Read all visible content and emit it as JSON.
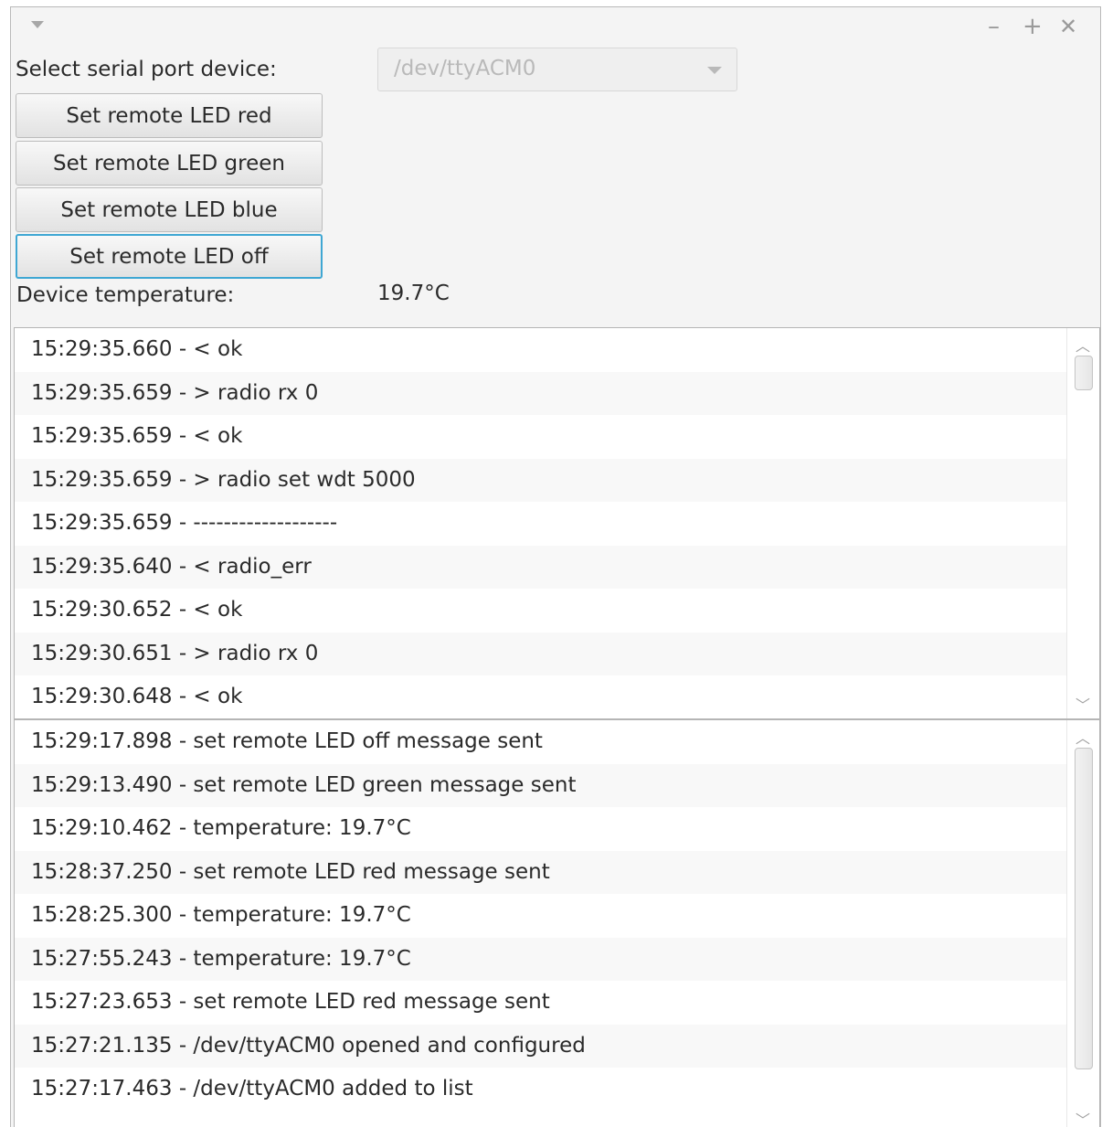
{
  "window": {
    "minimize": "–",
    "maximize": "+",
    "close": "✕"
  },
  "port": {
    "label": "Select serial port device:",
    "selected": "/dev/ttyACM0"
  },
  "buttons": {
    "red": "Set remote LED red",
    "green": "Set remote LED green",
    "blue": "Set remote LED blue",
    "off": "Set remote LED off"
  },
  "temperature": {
    "label": "Device temperature:",
    "value": "19.7°C"
  },
  "serial_log": [
    "15:29:35.660 - < ok",
    "15:29:35.659 - > radio rx 0",
    "15:29:35.659 - < ok",
    "15:29:35.659 - > radio set wdt 5000",
    "15:29:35.659 - -------------------",
    "15:29:35.640 - < radio_err",
    "15:29:30.652 - < ok",
    "15:29:30.651 - > radio rx 0",
    "15:29:30.648 - < ok"
  ],
  "event_log": [
    "15:29:17.898 - set remote LED off message sent",
    "15:29:13.490 - set remote LED green message sent",
    "15:29:10.462 - temperature: 19.7°C",
    "15:28:37.250 - set remote LED red message sent",
    "15:28:25.300 - temperature: 19.7°C",
    "15:27:55.243 - temperature: 19.7°C",
    "15:27:23.653 - set remote LED red message sent",
    "15:27:21.135 - /dev/ttyACM0 opened and configured",
    "15:27:17.463 - /dev/ttyACM0 added to list"
  ],
  "icons": {
    "menu": "triangle-down-icon",
    "minimize": "minimize-icon",
    "maximize": "maximize-icon",
    "close": "close-icon",
    "scroll_up": "chevron-up-icon",
    "scroll_down": "chevron-down-icon"
  },
  "colors": {
    "focus_ring": "#3fa7d3",
    "window_bg": "#f4f4f4",
    "list_bg": "#ffffff"
  }
}
